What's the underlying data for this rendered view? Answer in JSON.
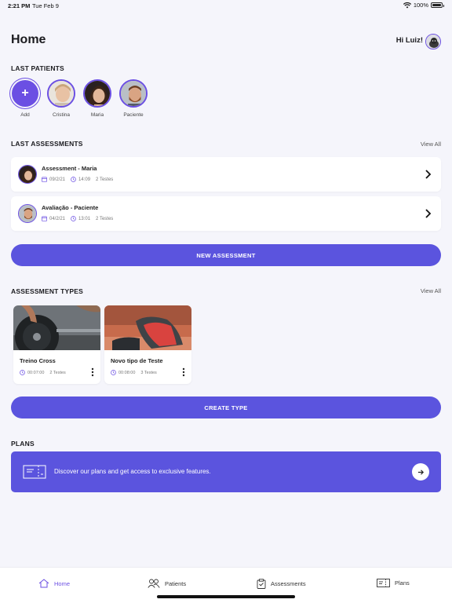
{
  "status_bar": {
    "time": "2:21 PM",
    "date": "Tue Feb 9",
    "battery": "100%"
  },
  "header": {
    "title": "Home",
    "greeting": "Hi Luiz!"
  },
  "last_patients": {
    "title": "LAST PATIENTS",
    "add_label": "Add",
    "items": [
      {
        "name": "Cristina"
      },
      {
        "name": "Maria"
      },
      {
        "name": "Paciente"
      }
    ]
  },
  "last_assessments": {
    "title": "LAST ASSESSMENTS",
    "view_all": "View All",
    "items": [
      {
        "title": "Assessment - Maria",
        "date": "09/2/21",
        "time": "14:09",
        "tests": "2 Testes"
      },
      {
        "title": "Avaliação - Paciente",
        "date": "04/2/21",
        "time": "13:01",
        "tests": "2 Testes"
      }
    ]
  },
  "new_assessment_button": "NEW ASSESSMENT",
  "assessment_types": {
    "title": "ASSESSMENT TYPES",
    "view_all": "View All",
    "items": [
      {
        "title": "Treino Cross",
        "duration": "00:07:00",
        "tests": "2 Testes"
      },
      {
        "title": "Novo tipo de Teste",
        "duration": "00:08:00",
        "tests": "3 Testes"
      }
    ]
  },
  "create_type_button": "CREATE TYPE",
  "plans": {
    "title": "PLANS",
    "banner_text": "Discover our plans and get access to exclusive features."
  },
  "tabbar": {
    "items": [
      {
        "label": "Home",
        "icon": "home-icon",
        "active": true
      },
      {
        "label": "Patients",
        "icon": "patients-icon",
        "active": false
      },
      {
        "label": "Assessments",
        "icon": "clipboard-icon",
        "active": false
      },
      {
        "label": "Plans",
        "icon": "plans-icon",
        "active": false
      }
    ]
  },
  "colors": {
    "accent": "#5b54de",
    "accent_ring": "#6b4fe3",
    "background": "#f5f5fb"
  }
}
